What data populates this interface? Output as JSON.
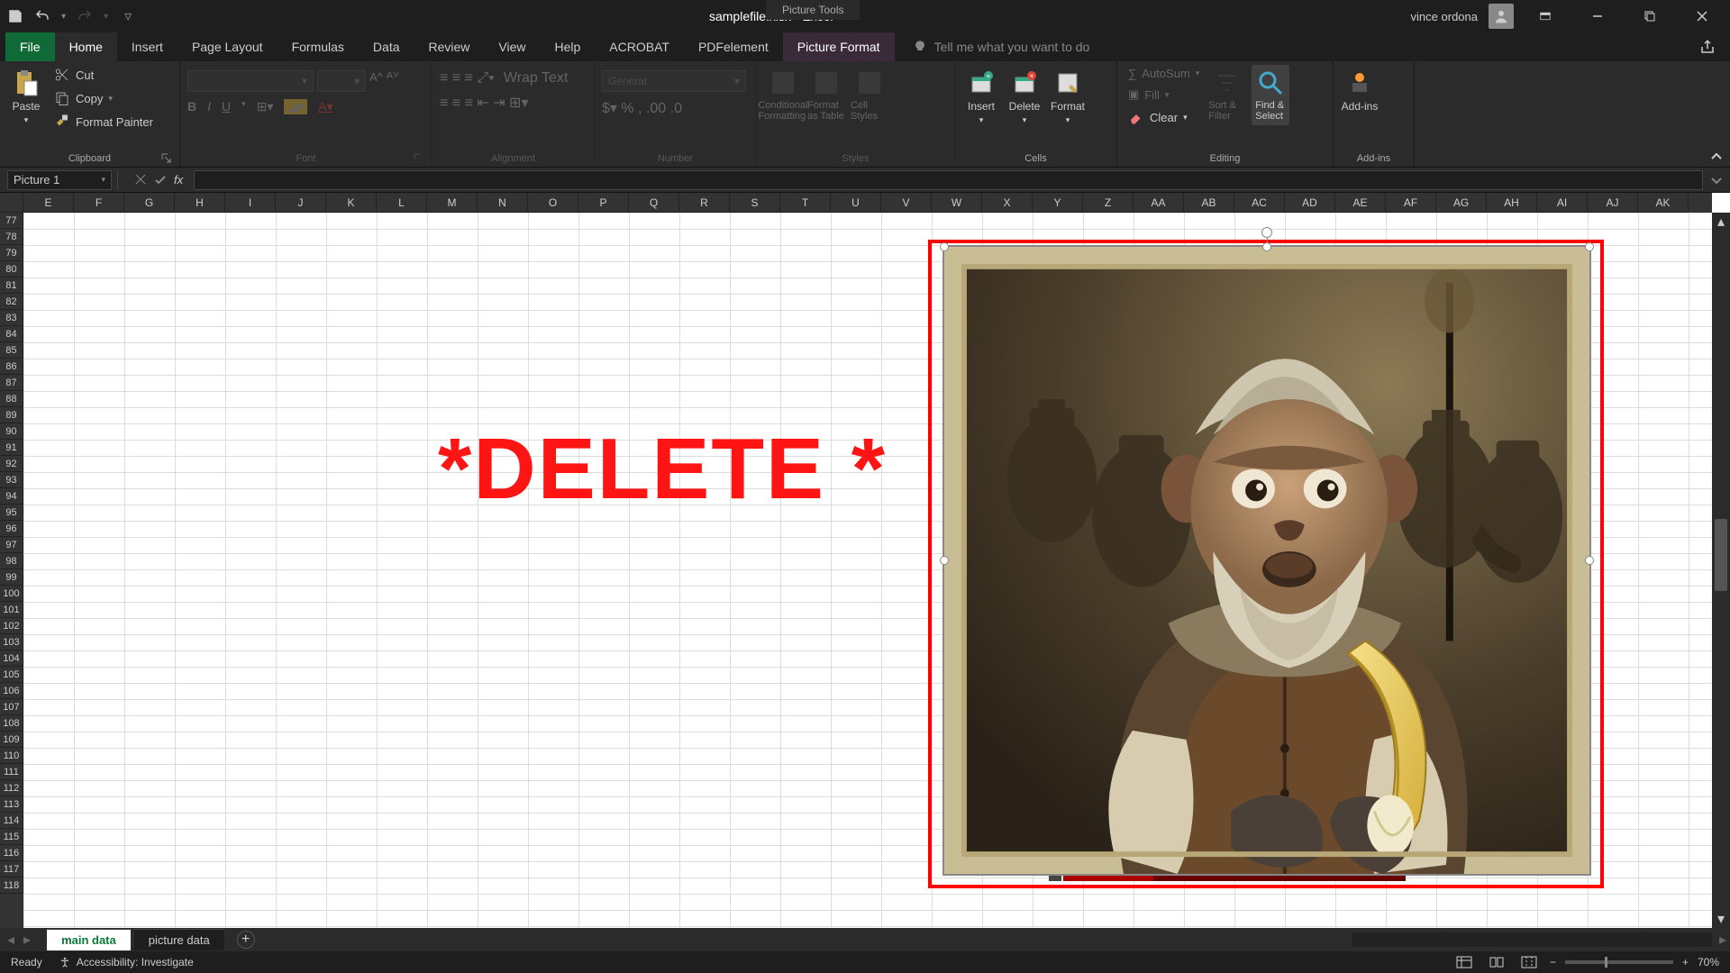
{
  "titlebar": {
    "filename": "samplefile.xlsx - Excel",
    "picture_tools": "Picture Tools",
    "user": "vince ordona"
  },
  "tabs": {
    "file": "File",
    "home": "Home",
    "insert": "Insert",
    "page_layout": "Page Layout",
    "formulas": "Formulas",
    "data": "Data",
    "review": "Review",
    "view": "View",
    "help": "Help",
    "acrobat": "ACROBAT",
    "pdfelement": "PDFelement",
    "picture_format": "Picture Format",
    "tellme": "Tell me what you want to do"
  },
  "ribbon": {
    "clipboard": {
      "label": "Clipboard",
      "paste": "Paste",
      "cut": "Cut",
      "copy": "Copy",
      "format_painter": "Format Painter"
    },
    "font": {
      "label": "Font"
    },
    "alignment": {
      "label": "Alignment",
      "wrap": "Wrap Text"
    },
    "number": {
      "label": "Number",
      "format": "General"
    },
    "styles": {
      "label": "Styles",
      "cond": "Conditional Formatting",
      "table": "Format as Table",
      "cell": "Cell Styles"
    },
    "cells": {
      "label": "Cells",
      "insert": "Insert",
      "delete": "Delete",
      "format": "Format"
    },
    "editing": {
      "label": "Editing",
      "autosum": "AutoSum",
      "fill": "Fill",
      "clear": "Clear",
      "sort": "Sort & Filter",
      "find": "Find & Select"
    },
    "addins": {
      "label": "Add-ins",
      "addins": "Add-ins"
    }
  },
  "namebox": {
    "value": "Picture 1"
  },
  "grid": {
    "columns": [
      "E",
      "F",
      "G",
      "H",
      "I",
      "J",
      "K",
      "L",
      "M",
      "N",
      "O",
      "P",
      "Q",
      "R",
      "S",
      "T",
      "U",
      "V",
      "W",
      "X",
      "Y",
      "Z",
      "AA",
      "AB",
      "AC",
      "AD",
      "AE",
      "AF",
      "AG",
      "AH",
      "AI",
      "AJ",
      "AK"
    ],
    "rows": [
      77,
      78,
      79,
      80,
      81,
      82,
      83,
      84,
      85,
      86,
      87,
      88,
      89,
      90,
      91,
      92,
      93,
      94,
      95,
      96,
      97,
      98,
      99,
      100,
      101,
      102,
      103,
      104,
      105,
      106,
      107,
      108,
      109,
      110,
      111,
      112,
      113,
      114,
      115,
      116,
      117,
      118
    ],
    "overlay_text": "*DELETE *"
  },
  "sheets": {
    "active": "main data",
    "other": "picture data"
  },
  "status": {
    "ready": "Ready",
    "accessibility": "Accessibility: Investigate",
    "zoom": "70%"
  }
}
